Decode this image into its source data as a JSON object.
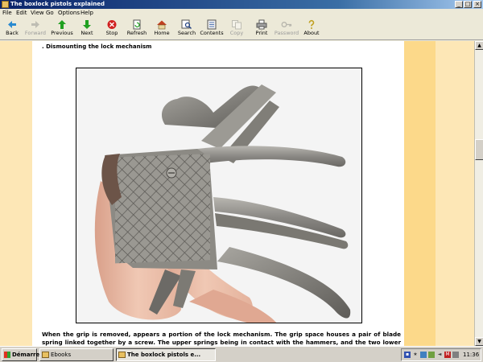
{
  "window": {
    "title": "The boxlock pistols explained",
    "controls": [
      "_",
      "□",
      "×"
    ]
  },
  "menu": [
    "File",
    "Edit",
    "View",
    "Go",
    "Options",
    "Help"
  ],
  "toolbar": [
    {
      "label": "Back",
      "icon": "back-arrow-icon",
      "enabled": true
    },
    {
      "label": "Forward",
      "icon": "forward-arrow-icon",
      "enabled": false
    },
    {
      "label": "Previous",
      "icon": "up-arrow-icon",
      "enabled": true
    },
    {
      "label": "Next",
      "icon": "down-arrow-icon",
      "enabled": true
    },
    {
      "label": "Stop",
      "icon": "stop-icon",
      "enabled": true
    },
    {
      "label": "Refresh",
      "icon": "refresh-icon",
      "enabled": true
    },
    {
      "label": "Home",
      "icon": "home-icon",
      "enabled": true
    },
    {
      "label": "Search",
      "icon": "search-icon",
      "enabled": true
    },
    {
      "label": "Contents",
      "icon": "contents-icon",
      "enabled": true
    },
    {
      "label": "Copy",
      "icon": "copy-icon",
      "enabled": false
    },
    {
      "label": "Print",
      "icon": "print-icon",
      "enabled": true
    },
    {
      "label": "Password",
      "icon": "key-icon",
      "enabled": false
    },
    {
      "label": "About",
      "icon": "about-icon",
      "enabled": true
    }
  ],
  "content": {
    "heading": ". Dismounting the lock mechanism",
    "body": "When the grip is removed, appears a portion of the lock mechanism. The grip space houses a pair of blade spring linked together by a screw. The upper springs being in contact with the hammers, and the two lower ones acting on"
  },
  "taskbar": {
    "start": "Démarrer",
    "tasks": [
      {
        "label": "Ebooks",
        "active": false
      },
      {
        "label": "The boxlock pistols e...",
        "active": true
      }
    ],
    "clock": "11:36"
  },
  "colors": {
    "page_band_light": "#fde7b6",
    "page_band_dark": "#fcd98a",
    "titlebar": "#0a246a"
  }
}
